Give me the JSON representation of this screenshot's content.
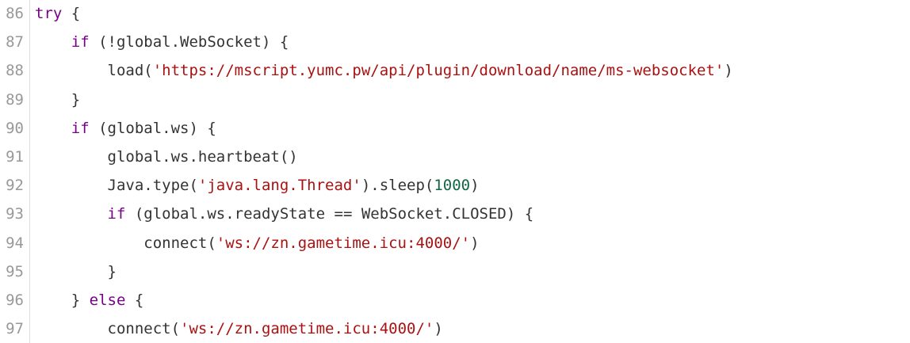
{
  "code_lines": [
    {
      "n": "86",
      "tokens": [
        {
          "t": "kw",
          "v": "try"
        },
        {
          "t": "txt",
          "v": " {"
        }
      ]
    },
    {
      "n": "87",
      "tokens": [
        {
          "t": "txt",
          "v": "    "
        },
        {
          "t": "kw",
          "v": "if"
        },
        {
          "t": "txt",
          "v": " (!global.WebSocket) {"
        }
      ]
    },
    {
      "n": "88",
      "tokens": [
        {
          "t": "txt",
          "v": "        load("
        },
        {
          "t": "str",
          "v": "'https://mscript.yumc.pw/api/plugin/download/name/ms-websocket'"
        },
        {
          "t": "txt",
          "v": ")"
        }
      ]
    },
    {
      "n": "89",
      "tokens": [
        {
          "t": "txt",
          "v": "    }"
        }
      ]
    },
    {
      "n": "90",
      "tokens": [
        {
          "t": "txt",
          "v": "    "
        },
        {
          "t": "kw",
          "v": "if"
        },
        {
          "t": "txt",
          "v": " (global.ws) {"
        }
      ]
    },
    {
      "n": "91",
      "tokens": [
        {
          "t": "txt",
          "v": "        global.ws.heartbeat()"
        }
      ]
    },
    {
      "n": "92",
      "tokens": [
        {
          "t": "txt",
          "v": "        Java.type("
        },
        {
          "t": "str",
          "v": "'java.lang.Thread'"
        },
        {
          "t": "txt",
          "v": ").sleep("
        },
        {
          "t": "num",
          "v": "1000"
        },
        {
          "t": "txt",
          "v": ")"
        }
      ]
    },
    {
      "n": "93",
      "tokens": [
        {
          "t": "txt",
          "v": "        "
        },
        {
          "t": "kw",
          "v": "if"
        },
        {
          "t": "txt",
          "v": " (global.ws.readyState == WebSocket.CLOSED) {"
        }
      ]
    },
    {
      "n": "94",
      "tokens": [
        {
          "t": "txt",
          "v": "            connect("
        },
        {
          "t": "str",
          "v": "'ws://zn.gametime.icu:4000/'"
        },
        {
          "t": "txt",
          "v": ")"
        }
      ]
    },
    {
      "n": "95",
      "tokens": [
        {
          "t": "txt",
          "v": "        }"
        }
      ]
    },
    {
      "n": "96",
      "tokens": [
        {
          "t": "txt",
          "v": "    } "
        },
        {
          "t": "kw",
          "v": "else"
        },
        {
          "t": "txt",
          "v": " {"
        }
      ]
    },
    {
      "n": "97",
      "tokens": [
        {
          "t": "txt",
          "v": "        connect("
        },
        {
          "t": "str",
          "v": "'ws://zn.gametime.icu:4000/'"
        },
        {
          "t": "txt",
          "v": ")"
        }
      ]
    }
  ],
  "colors": {
    "keyword": "#770088",
    "string": "#aa1111",
    "number": "#116644",
    "text": "#333333",
    "line_number": "#999999"
  }
}
